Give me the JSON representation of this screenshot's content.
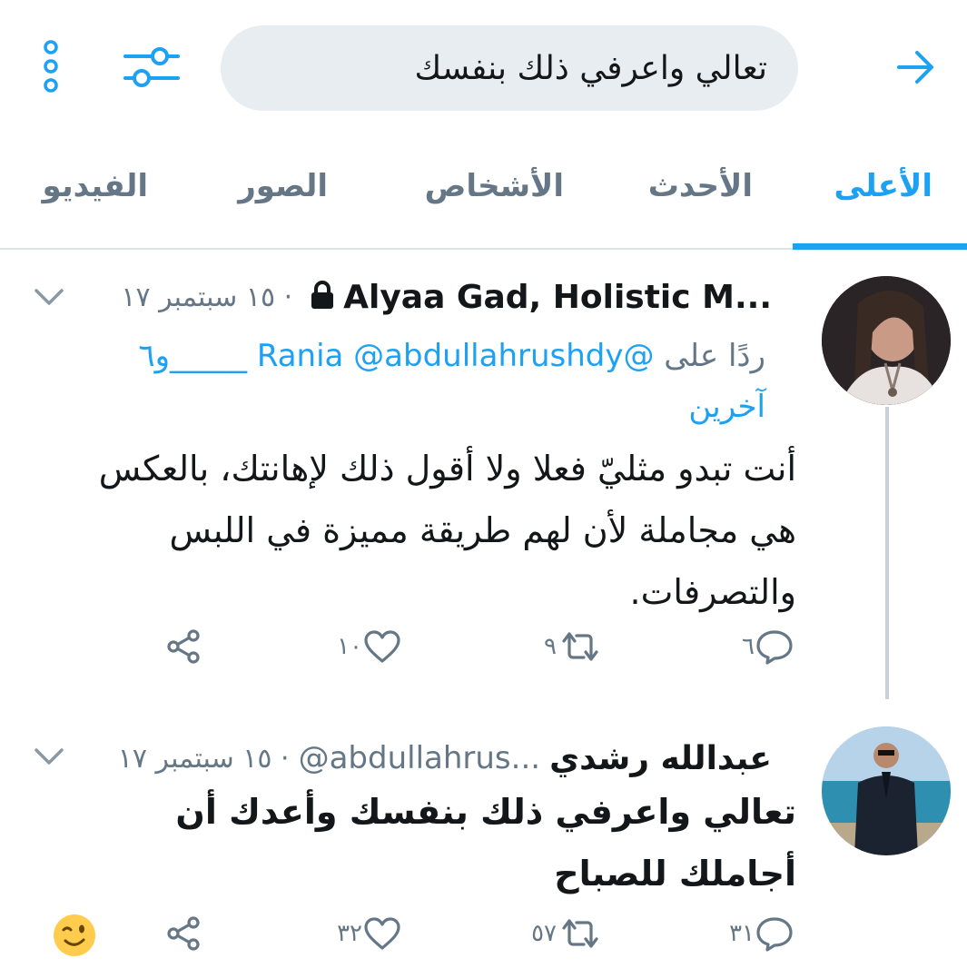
{
  "search": {
    "query": "تعالي واعرفي ذلك بنفسك"
  },
  "icons": {
    "back": "arrow-right-icon",
    "filter": "sliders-icon",
    "more": "more-vertical-icon"
  },
  "tabs": [
    {
      "label": "الأعلى",
      "active": true
    },
    {
      "label": "الأحدث",
      "active": false
    },
    {
      "label": "الأشخاص",
      "active": false
    },
    {
      "label": "الصور",
      "active": false
    },
    {
      "label": "الفيديو",
      "active": false
    }
  ],
  "colors": {
    "accent": "#1da1f2",
    "muted": "#657786",
    "search_bg": "#e8edf1"
  },
  "tweets": [
    {
      "name": "Alyaa Gad, Holistic M...",
      "meta": "· ١٥ سبتمبر ١٧",
      "protected": true,
      "reply_prefix": "ردًا على",
      "reply_mentions": "@Rania @abdullahrushdy",
      "reply_more_a": "_____و٦",
      "reply_more_b": "آخرين",
      "body_line1": "أنت تبدو مثليّ فعلا ولا أقول ذلك لإهانتك، بالعكس",
      "body_line2": "هي مجاملة لأن لهم طريقة مميزة في اللبس",
      "body_line3": "والتصرفات.",
      "replies": "٦",
      "retweets": "٩",
      "likes": "١٠"
    },
    {
      "name": "عبدالله رشدي",
      "handle": "@abdullahrus...",
      "meta": "· ١٥ سبتمبر ١٧",
      "body_line1": "تعالي واعرفي ذلك بنفسك وأعدك أن أجاملك للصباح",
      "replies": "٣١",
      "retweets": "٥٧",
      "likes": "٣٢"
    }
  ]
}
